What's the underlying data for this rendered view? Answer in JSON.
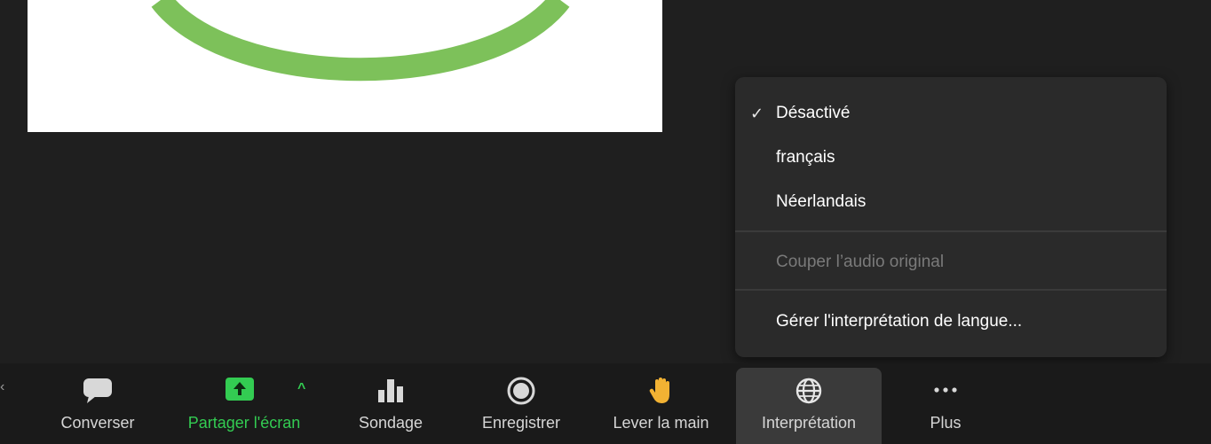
{
  "colors": {
    "background": "#1f1f1f",
    "menu_background": "#2a2a2a",
    "toolbar_background": "#1a1a1a",
    "share_accent": "#33cc52",
    "preview_ring": "#7dc15a"
  },
  "menu": {
    "items": [
      {
        "label": "Désactivé",
        "checked": true,
        "enabled": true
      },
      {
        "label": "français",
        "checked": false,
        "enabled": true
      },
      {
        "label": "Néerlandais",
        "checked": false,
        "enabled": true
      }
    ],
    "mute_original": {
      "label": "Couper l’audio original",
      "enabled": false
    },
    "manage": {
      "label": "Gérer l'interprétation de langue..."
    },
    "check_glyph": "✓"
  },
  "toolbar": {
    "chat": {
      "label": "Converser",
      "icon": "chat-bubble-icon"
    },
    "share": {
      "label": "Partager l'écran",
      "icon": "share-screen-arrow-icon"
    },
    "poll": {
      "label": "Sondage",
      "icon": "bar-chart-icon"
    },
    "record": {
      "label": "Enregistrer",
      "icon": "record-icon"
    },
    "raise_hand": {
      "label": "Lever la main",
      "icon": "raised-hand-icon"
    },
    "interpretation": {
      "label": "Interprétation",
      "icon": "globe-icon",
      "active": true
    },
    "more": {
      "label": "Plus",
      "icon": "ellipsis-icon"
    }
  }
}
